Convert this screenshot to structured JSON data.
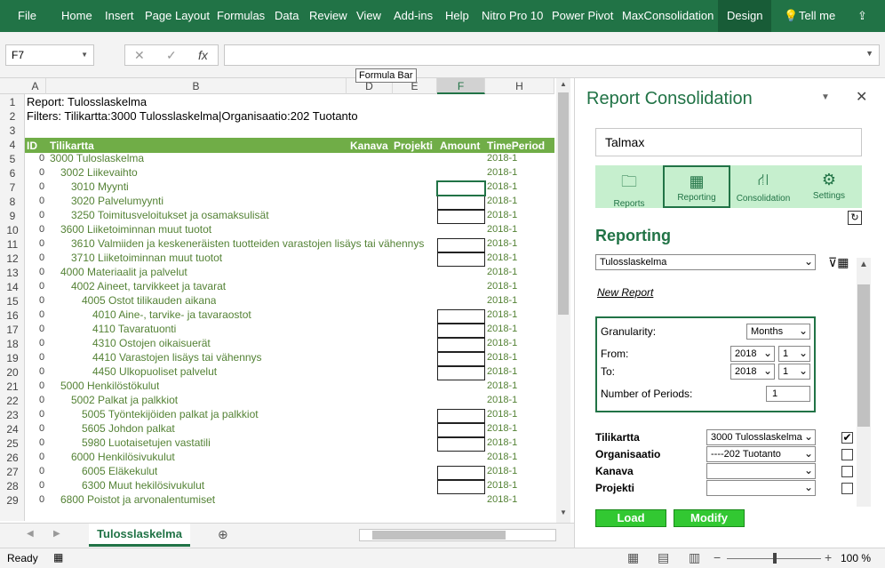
{
  "ribbon": {
    "tabs": [
      "File",
      "Home",
      "Insert",
      "Page Layout",
      "Formulas",
      "Data",
      "Review",
      "View",
      "Add-ins",
      "Help",
      "Nitro Pro 10",
      "Power Pivot",
      "MaxConsolidation",
      "Design"
    ],
    "tell_me": "Tell me",
    "bg": "#217346"
  },
  "formula_bar": {
    "name_box": "F7",
    "fx": "fx",
    "value": "",
    "tooltip": "Formula Bar"
  },
  "columns": [
    "A",
    "B",
    "D",
    "E",
    "F",
    "H"
  ],
  "selected_column": "F",
  "rows": [
    {
      "n": "1",
      "id": "",
      "text": "Report: Tulosslaskelma",
      "time": ""
    },
    {
      "n": "2",
      "id": "",
      "text": "Filters: Tilikartta:3000 Tulosslaskelma|Organisaatio:202 Tuotanto",
      "time": ""
    },
    {
      "n": "3",
      "id": "",
      "text": "",
      "time": ""
    },
    {
      "n": "4",
      "id": "ID",
      "text": "Tilikartta",
      "time": "TimePeriod"
    },
    {
      "n": "5",
      "id": "0",
      "text": "3000 Tuloslaskelma",
      "time": "2018-1"
    },
    {
      "n": "6",
      "id": "0",
      "text": "3002 Liikevaihto",
      "time": "2018-1"
    },
    {
      "n": "7",
      "id": "0",
      "text": "3010 Myynti",
      "time": "2018-1"
    },
    {
      "n": "8",
      "id": "0",
      "text": "3020 Palvelumyynti",
      "time": "2018-1"
    },
    {
      "n": "9",
      "id": "0",
      "text": "3250 Toimitusveloitukset ja osamaksulisät",
      "time": "2018-1"
    },
    {
      "n": "10",
      "id": "0",
      "text": "3600 Liiketoiminnan muut tuotot",
      "time": "2018-1"
    },
    {
      "n": "11",
      "id": "0",
      "text": "3610 Valmiiden ja keskeneräisten tuotteiden varastojen lisäys tai vähennys",
      "time": "2018-1"
    },
    {
      "n": "12",
      "id": "0",
      "text": "3710 Liiketoiminnan muut tuotot",
      "time": "2018-1"
    },
    {
      "n": "13",
      "id": "0",
      "text": "4000 Materiaalit ja palvelut",
      "time": "2018-1"
    },
    {
      "n": "14",
      "id": "0",
      "text": "4002 Aineet, tarvikkeet ja tavarat",
      "time": "2018-1"
    },
    {
      "n": "15",
      "id": "0",
      "text": "4005 Ostot tilikauden aikana",
      "time": "2018-1"
    },
    {
      "n": "16",
      "id": "0",
      "text": "4010 Aine-, tarvike- ja tavaraostot",
      "time": "2018-1"
    },
    {
      "n": "17",
      "id": "0",
      "text": "4110 Tavaratuonti",
      "time": "2018-1"
    },
    {
      "n": "18",
      "id": "0",
      "text": "4310 Ostojen oikaisuerät",
      "time": "2018-1"
    },
    {
      "n": "19",
      "id": "0",
      "text": "4410 Varastojen lisäys tai vähennys",
      "time": "2018-1"
    },
    {
      "n": "20",
      "id": "0",
      "text": "4450 Ulkopuoliset palvelut",
      "time": "2018-1"
    },
    {
      "n": "21",
      "id": "0",
      "text": "5000 Henkilöstökulut",
      "time": "2018-1"
    },
    {
      "n": "22",
      "id": "0",
      "text": "5002 Palkat ja palkkiot",
      "time": "2018-1"
    },
    {
      "n": "23",
      "id": "0",
      "text": "5005 Työntekijöiden palkat ja palkkiot",
      "time": "2018-1"
    },
    {
      "n": "24",
      "id": "0",
      "text": "5605 Johdon palkat",
      "time": "2018-1"
    },
    {
      "n": "25",
      "id": "0",
      "text": "5980 Luotaisetujen vastatili",
      "time": "2018-1"
    },
    {
      "n": "26",
      "id": "0",
      "text": "6000 Henkilösivukulut",
      "time": "2018-1"
    },
    {
      "n": "27",
      "id": "0",
      "text": "6005 Eläkekulut",
      "time": "2018-1"
    },
    {
      "n": "28",
      "id": "0",
      "text": "6300 Muut hekilösivukulut",
      "time": "2018-1"
    },
    {
      "n": "29",
      "id": "0",
      "text": "6800 Poistot ja arvonalentumiset",
      "time": "2018-1"
    }
  ],
  "header_row": {
    "kanava": "Kanava",
    "projekti": "Projekti",
    "amount": "Amount"
  },
  "sheet_tab": "Tulosslaskelma",
  "status": {
    "ready": "Ready",
    "zoom": "100 %"
  },
  "panel": {
    "title": "Report Consolidation",
    "search": "Talmax",
    "nav": [
      "Reports",
      "Reporting",
      "Consolidation",
      "Settings"
    ],
    "section": "Reporting",
    "report_select": "Tulosslaskelma",
    "new_report": "New Report",
    "granularity_label": "Granularity:",
    "granularity": "Months",
    "from_label": "From:",
    "to_label": "To:",
    "from_year": "2018",
    "from_period": "1",
    "to_year": "2018",
    "to_period": "1",
    "periods_label": "Number of Periods:",
    "periods": "1",
    "dims": [
      {
        "label": "Tilikartta",
        "value": "3000 Tulosslaskelma",
        "checked": "✔"
      },
      {
        "label": "Organisaatio",
        "value": "----202 Tuotanto",
        "checked": ""
      },
      {
        "label": "Kanava",
        "value": "",
        "checked": ""
      },
      {
        "label": "Projekti",
        "value": "",
        "checked": ""
      }
    ],
    "load": "Load",
    "modify": "Modify"
  }
}
